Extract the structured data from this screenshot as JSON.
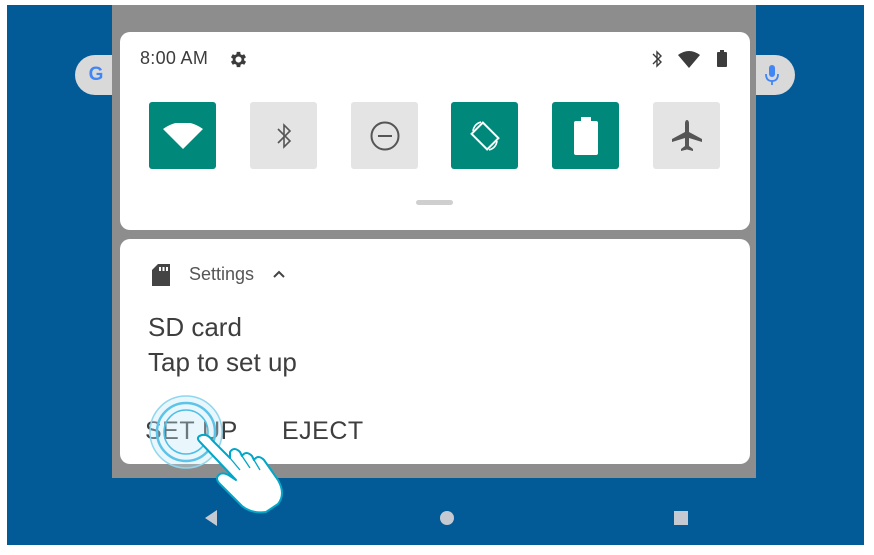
{
  "status_bar": {
    "time": "8:00 AM",
    "icons": [
      "gear-icon",
      "bluetooth-icon",
      "wifi-icon",
      "battery-icon"
    ]
  },
  "home": {
    "search_logo": "G",
    "search_icons": [
      "google-logo",
      "mic-icon"
    ]
  },
  "quick_settings": {
    "tiles": [
      {
        "name": "wifi",
        "icon": "wifi-icon",
        "state": "on"
      },
      {
        "name": "bluetooth",
        "icon": "bluetooth-icon",
        "state": "off"
      },
      {
        "name": "do-not-disturb",
        "icon": "do-not-disturb-icon",
        "state": "off"
      },
      {
        "name": "auto-rotate",
        "icon": "auto-rotate-icon",
        "state": "on"
      },
      {
        "name": "battery-saver",
        "icon": "battery-icon",
        "state": "on"
      },
      {
        "name": "airplane-mode",
        "icon": "airplane-icon",
        "state": "off"
      }
    ]
  },
  "notification": {
    "app_icon": "sd-card-icon",
    "app_name": "Settings",
    "title": "SD card",
    "text": "Tap to set up",
    "actions": {
      "setup": "SET UP",
      "eject": "EJECT"
    }
  },
  "nav_bar": {
    "buttons": [
      "back-button",
      "home-button",
      "recents-button"
    ]
  },
  "colors": {
    "wallpaper": "#025b96",
    "tile_on": "#00887a",
    "tile_off": "#e4e4e4",
    "shade_scrim": "#8d8d8d"
  }
}
